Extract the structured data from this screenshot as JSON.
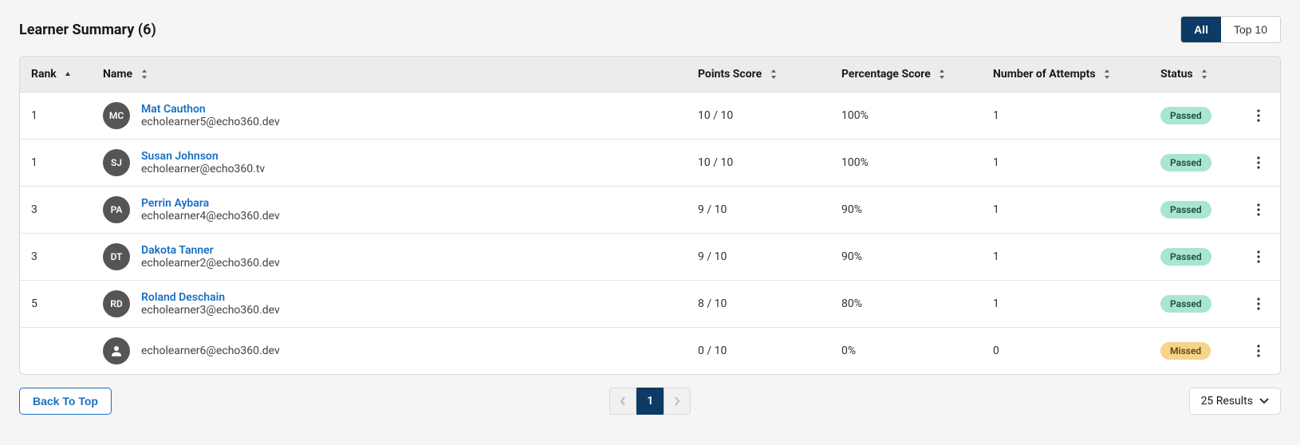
{
  "title": "Learner Summary (6)",
  "tabs": {
    "all": "All",
    "top10": "Top 10",
    "active": "all"
  },
  "columns": {
    "rank": "Rank",
    "name": "Name",
    "points": "Points Score",
    "percentage": "Percentage Score",
    "attempts": "Number of Attempts",
    "status": "Status"
  },
  "rows": [
    {
      "rank": "1",
      "initials": "MC",
      "avatarType": "initials",
      "name": "Mat Cauthon",
      "email": "echolearner5@echo360.dev",
      "points": "10 / 10",
      "percentage": "100%",
      "attempts": "1",
      "status": "Passed",
      "statusClass": "passed"
    },
    {
      "rank": "1",
      "initials": "SJ",
      "avatarType": "initials",
      "name": "Susan Johnson",
      "email": "echolearner@echo360.tv",
      "points": "10 / 10",
      "percentage": "100%",
      "attempts": "1",
      "status": "Passed",
      "statusClass": "passed"
    },
    {
      "rank": "3",
      "initials": "PA",
      "avatarType": "initials",
      "name": "Perrin Aybara",
      "email": "echolearner4@echo360.dev",
      "points": "9 / 10",
      "percentage": "90%",
      "attempts": "1",
      "status": "Passed",
      "statusClass": "passed"
    },
    {
      "rank": "3",
      "initials": "DT",
      "avatarType": "initials",
      "name": "Dakota Tanner",
      "email": "echolearner2@echo360.dev",
      "points": "9 / 10",
      "percentage": "90%",
      "attempts": "1",
      "status": "Passed",
      "statusClass": "passed"
    },
    {
      "rank": "5",
      "initials": "RD",
      "avatarType": "initials",
      "name": "Roland Deschain",
      "email": "echolearner3@echo360.dev",
      "points": "8 / 10",
      "percentage": "80%",
      "attempts": "1",
      "status": "Passed",
      "statusClass": "passed"
    },
    {
      "rank": "",
      "initials": "",
      "avatarType": "icon",
      "name": "",
      "email": "echolearner6@echo360.dev",
      "points": "0 / 10",
      "percentage": "0%",
      "attempts": "0",
      "status": "Missed",
      "statusClass": "missed"
    }
  ],
  "footer": {
    "back_to_top": "Back To Top",
    "current_page": "1",
    "results_label": "25 Results"
  }
}
